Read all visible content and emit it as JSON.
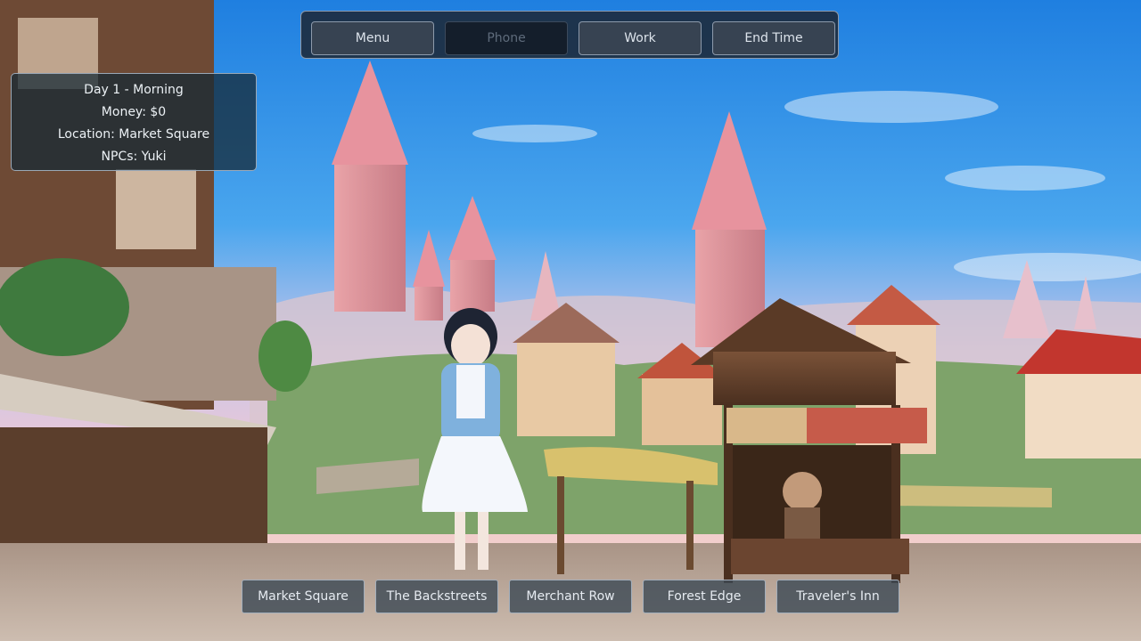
{
  "top_menu": {
    "menu_label": "Menu",
    "phone_label": "Phone",
    "work_label": "Work",
    "end_time_label": "End Time"
  },
  "status": {
    "day": "Day 1 - Morning",
    "money": "Money: $0",
    "location": "Location: Market Square",
    "npcs": "NPCs: Yuki"
  },
  "locations": [
    "Market Square",
    "The Backstreets",
    "Merchant Row",
    "Forest Edge",
    "Traveler's Inn"
  ],
  "colors": {
    "panel_bg": "#1c222c",
    "button_bg": "#3a4452",
    "button_disabled_bg": "#141c28",
    "border": "#8d9aab"
  }
}
